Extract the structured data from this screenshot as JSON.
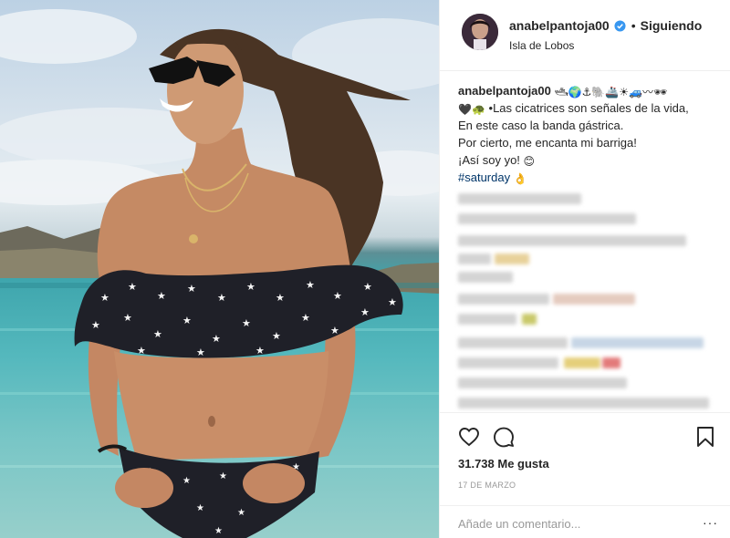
{
  "post": {
    "username": "anabelpantoja00",
    "follow_status": "Siguiendo",
    "separator": "•",
    "location": "Isla de Lobos"
  },
  "caption": {
    "username": "anabelpantoja00",
    "emoji_tail": "🛥🌍⚓🐘🚢☀🚙〰🕶",
    "emoji_lead": "🖤🐢",
    "line1": "•Las cicatrices son señales de la vida,",
    "line2": "En este caso la banda gástrica.",
    "line3": "Por cierto, me encanta mi barriga!",
    "line4": "¡Así soy yo!",
    "line4_emoji": "😊",
    "hashtag": "#saturday",
    "hashtag_emoji": "👌"
  },
  "stats": {
    "likes": "31.738 Me gusta",
    "date": "17 DE MARZO"
  },
  "comment": {
    "placeholder": "Añade un comentario...",
    "more": "···"
  },
  "icons": {
    "verified": "verified-badge-icon",
    "like": "heart-icon",
    "comment": "comment-bubble-icon",
    "save": "bookmark-icon",
    "more": "more-options-icon"
  },
  "colors": {
    "verified": "#3897f0",
    "hashtag": "#003569",
    "muted": "#999999",
    "border": "#efefef"
  }
}
